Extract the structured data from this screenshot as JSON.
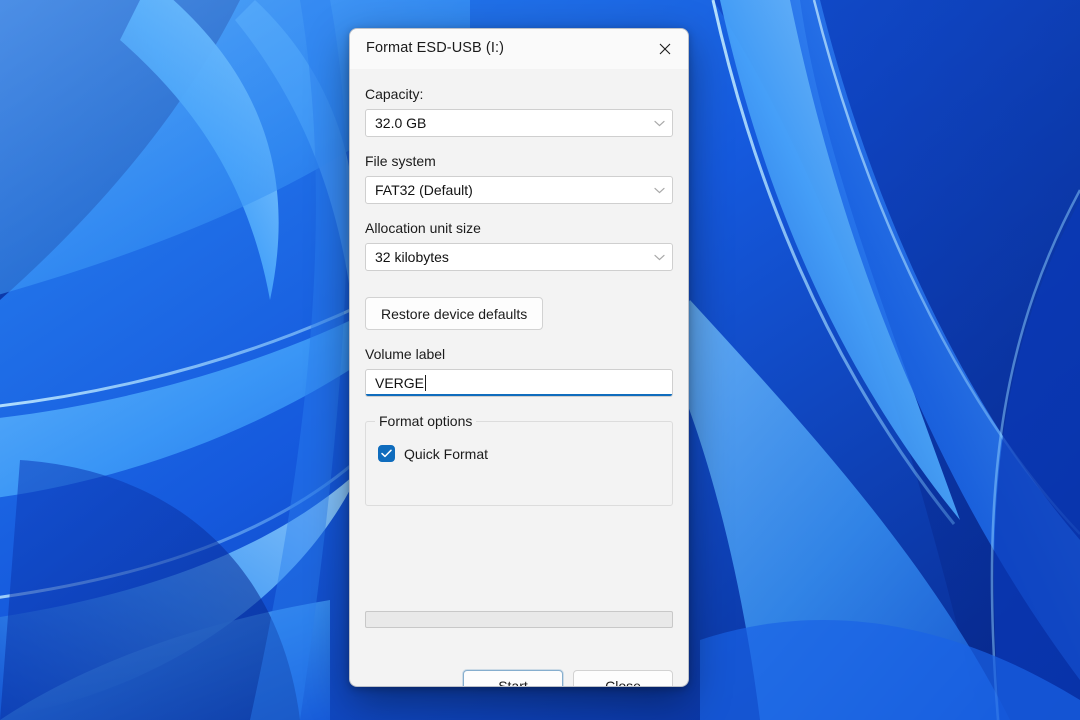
{
  "desktop": {
    "wallpaper_name": "windows-11-bloom-wallpaper",
    "colors": {
      "deep_blue": "#0a37bd",
      "mid_blue": "#1e6ce8",
      "bright_blue": "#3a9bfa",
      "light_blue": "#6fc0ff",
      "pale_blue": "#a8dcff"
    }
  },
  "dialog": {
    "title": "Format ESD-USB (I:)",
    "close_icon": "close-icon",
    "capacity": {
      "label": "Capacity:",
      "value": "32.0 GB",
      "chevron_icon": "chevron-down-icon"
    },
    "file_system": {
      "label": "File system",
      "value": "FAT32 (Default)",
      "chevron_icon": "chevron-down-icon"
    },
    "allocation_unit_size": {
      "label": "Allocation unit size",
      "value": "32 kilobytes",
      "chevron_icon": "chevron-down-icon"
    },
    "restore_defaults_label": "Restore device defaults",
    "volume_label": {
      "label": "Volume label",
      "value": "VERGE",
      "focused": "true"
    },
    "format_options": {
      "legend": "Format options",
      "quick_format": {
        "label": "Quick Format",
        "checked": "true",
        "check_icon": "checkmark-icon"
      }
    },
    "progress": {
      "percent": 0
    },
    "buttons": {
      "start_label": "Start",
      "close_label": "Close"
    },
    "accent_color": "#0f6cbd"
  }
}
